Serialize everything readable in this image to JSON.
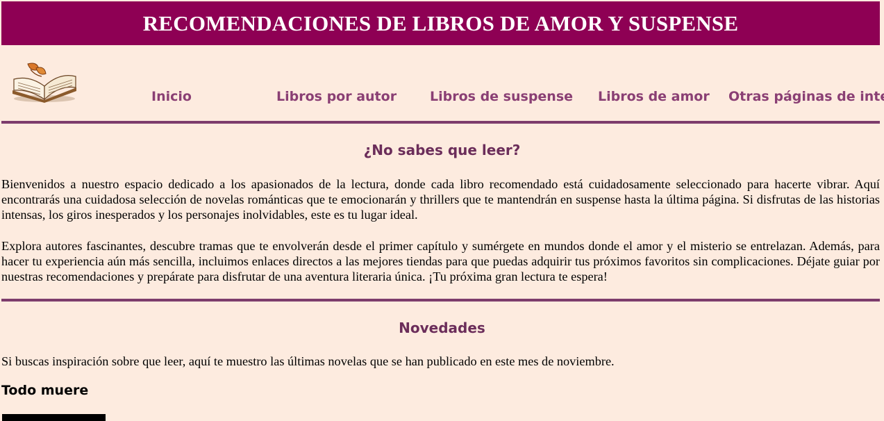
{
  "header": {
    "title": "RECOMENDACIONES DE LIBROS DE AMOR Y SUSPENSE"
  },
  "logo": {
    "icon": "open-book-icon"
  },
  "nav": {
    "items": [
      {
        "label": "Inicio"
      },
      {
        "label": "Libros por autor"
      },
      {
        "label": "Libros de suspense"
      },
      {
        "label": "Libros de amor"
      },
      {
        "label": "Otras páginas de interés"
      }
    ]
  },
  "intro": {
    "heading": "¿No sabes que leer?",
    "paragraphs": [
      "Bienvenidos a nuestro espacio dedicado a los apasionados de la lectura, donde cada libro recomendado está cuidadosamente seleccionado para hacerte vibrar. Aquí encontrarás una cuidadosa selección de novelas románticas que te emocionarán y thrillers que te mantendrán en suspense hasta la última página. Si disfrutas de las historias intensas, los giros inesperados y los personajes inolvidables, este es tu lugar ideal.",
      "Explora autores fascinantes, descubre tramas que te envolverán desde el primer capítulo y sumérgete en mundos donde el amor y el misterio se entrelazan. Además, para hacer tu experiencia aún más sencilla, incluimos enlaces directos a las mejores tiendas para que puedas adquirir tus próximos favoritos sin complicaciones. Déjate guiar por nuestras recomendaciones y prepárate para disfrutar de una aventura literaria única. ¡Tu próxima gran lectura te espera!"
    ]
  },
  "news": {
    "heading": "Novedades",
    "text": "Si buscas inspiración sobre que leer, aquí te muestro las últimas novelas que se han publicado en este mes de noviembre.",
    "book_title": "Todo muere"
  },
  "colors": {
    "banner": "#8e0054",
    "background": "#fdebdf",
    "nav_text": "#8a3f74",
    "headings": "#6b2d5a",
    "rule": "#7d3c6c"
  }
}
